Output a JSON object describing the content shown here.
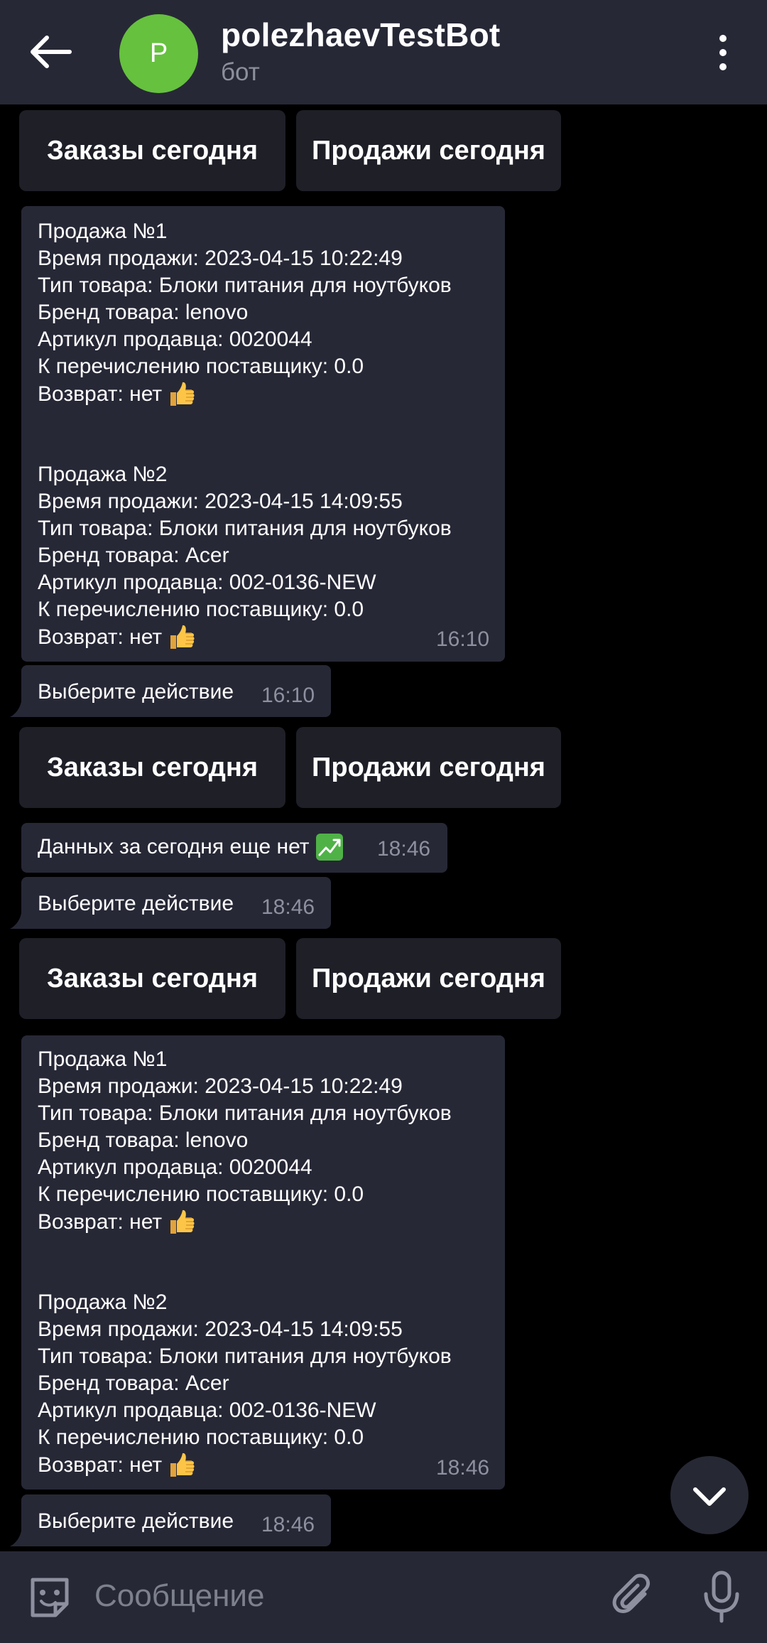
{
  "header": {
    "title": "polezhaevTestBot",
    "subtitle": "бот",
    "avatar_letter": "P",
    "avatar_color": "#66c13f",
    "back_icon": "arrow-left-icon",
    "menu_icon": "more-vertical-icon"
  },
  "keyboard": {
    "orders_label": "Заказы сегодня",
    "sales_label": "Продажи сегодня"
  },
  "messages": [
    {
      "lines": [
        "Продажа №1",
        "Время продажи: 2023-04-15 10:22:49",
        "Тип товара: Блоки питания для ноутбуков",
        "Бренд товара: lenovo",
        "Артикул продавца: 0020044",
        "К перечислению поставщику: 0.0",
        "Возврат: нет",
        "",
        "",
        "Продажа №2",
        "Время продажи: 2023-04-15 14:09:55",
        "Тип товара: Блоки питания для ноутбуков",
        "Бренд товара: Acer",
        "Артикул продавца: 002-0136-NEW",
        "К перечислению поставщику: 0.0",
        "Возврат: нет"
      ],
      "time": "16:10"
    },
    {
      "text": "Выберите действие",
      "time": "16:10"
    },
    {
      "text": "Данных за сегодня еще нет",
      "emoji": "chart-increasing-yen-icon",
      "time": "18:46"
    },
    {
      "text": "Выберите действие",
      "time": "18:46"
    },
    {
      "lines": [
        "Продажа №1",
        "Время продажи: 2023-04-15 10:22:49",
        "Тип товара: Блоки питания для ноутбуков",
        "Бренд товара: lenovo",
        "Артикул продавца: 0020044",
        "К перечислению поставщику: 0.0",
        "Возврат: нет",
        "",
        "",
        "Продажа №2",
        "Время продажи: 2023-04-15 14:09:55",
        "Тип товара: Блоки питания для ноутбуков",
        "Бренд товара: Acer",
        "Артикул продавца: 002-0136-NEW",
        "К перечислению поставщику: 0.0",
        "Возврат: нет"
      ],
      "time": "18:46"
    },
    {
      "text": "Выберите действие",
      "time": "18:46"
    }
  ],
  "composer": {
    "placeholder": "Сообщение",
    "emoji_icon": "sticker-smile-icon",
    "attach_icon": "paperclip-icon",
    "mic_icon": "microphone-icon"
  },
  "scroll_icon": "chevron-down-icon",
  "colors": {
    "header_bg": "#272836",
    "bubble_bg": "#272836",
    "keyboard_btn_bg": "#1e1f27",
    "chat_bg": "#000000",
    "time_text": "#8e90a0"
  }
}
